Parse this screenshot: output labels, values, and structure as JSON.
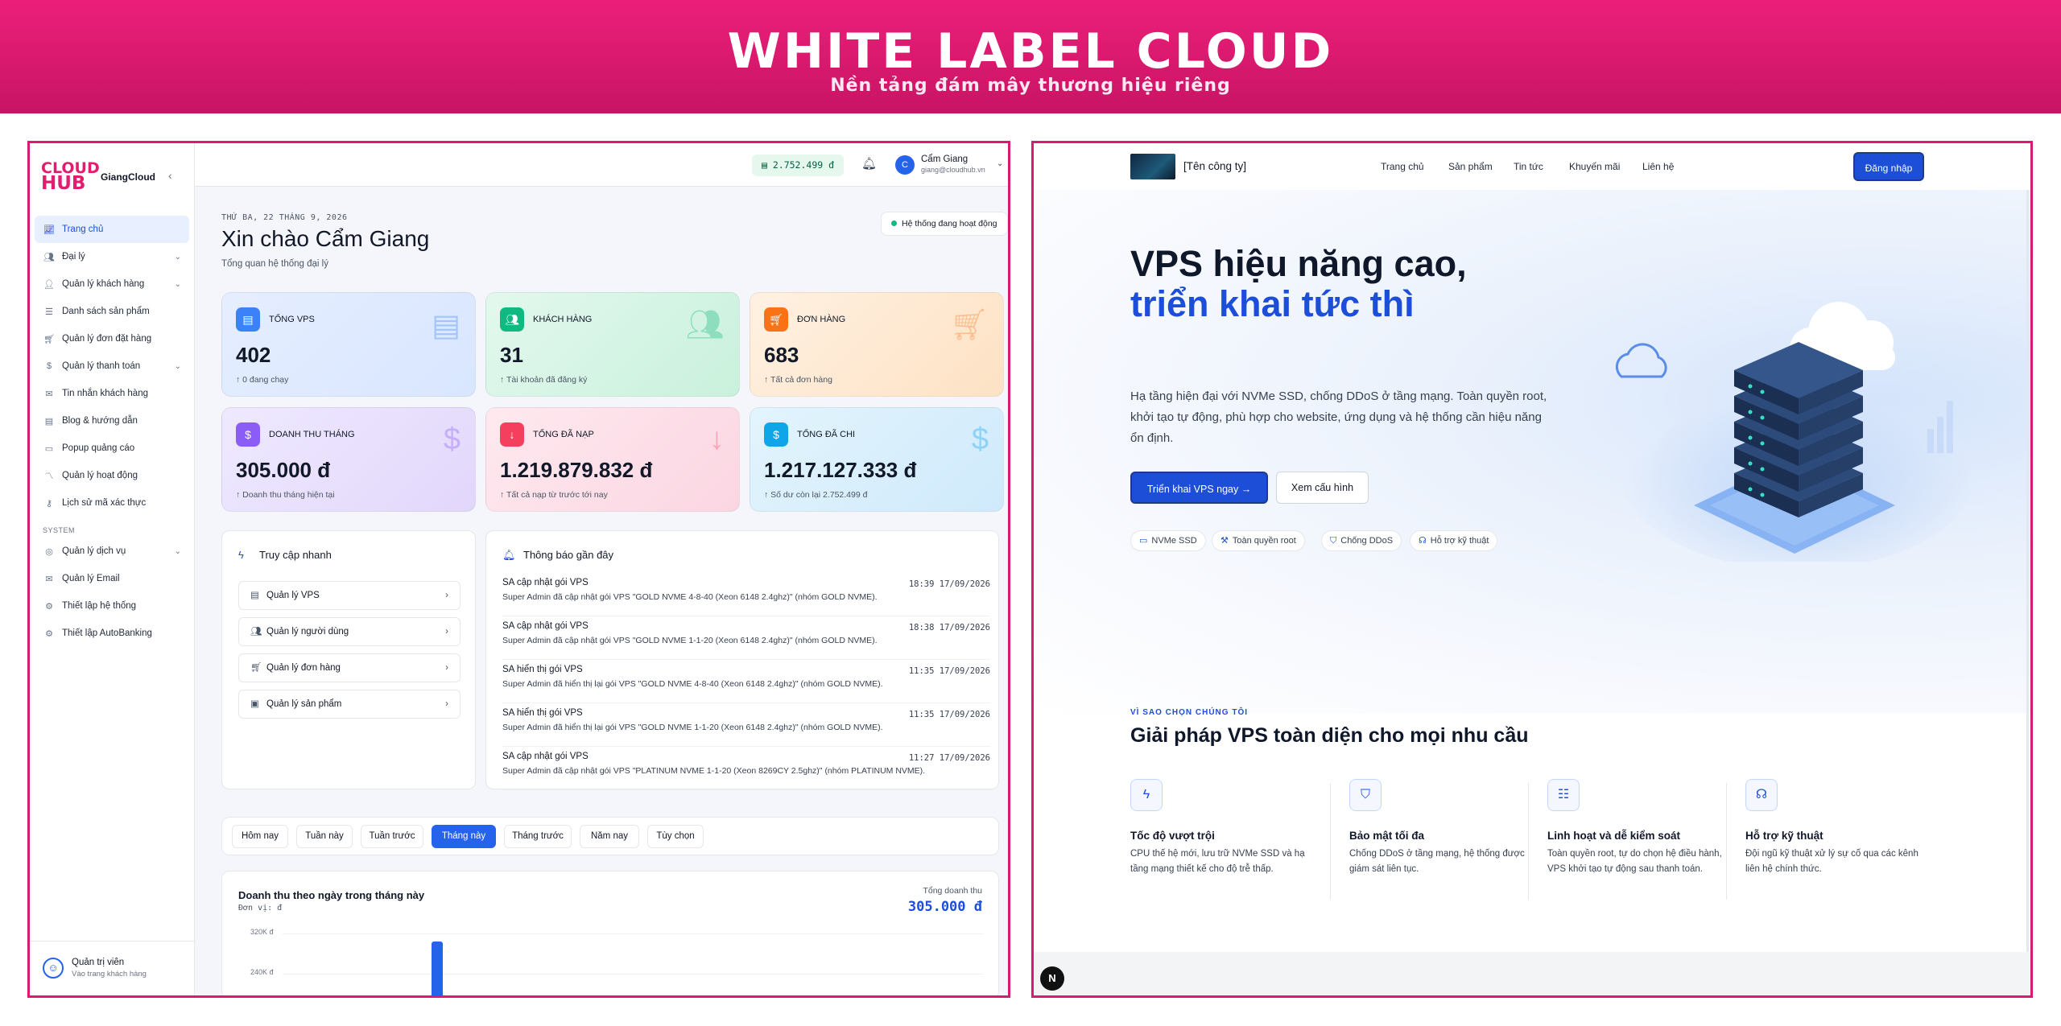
{
  "banner": {
    "title": "WHITE LABEL CLOUD",
    "subtitle": "Nền tảng đám mây thương hiệu riêng"
  },
  "admin": {
    "logo": {
      "line1": "CLOUD",
      "line2": "HUB"
    },
    "brand": "GiangCloud",
    "nav": [
      {
        "label": "Trang chủ",
        "icon": "chart-line-icon",
        "active": true
      },
      {
        "label": "Đại lý",
        "icon": "users-icon",
        "chevron": true
      },
      {
        "label": "Quản lý khách hàng",
        "icon": "user-icon",
        "chevron": true
      },
      {
        "label": "Danh sách sản phẩm",
        "icon": "list-icon"
      },
      {
        "label": "Quản lý đơn đặt hàng",
        "icon": "cart-icon"
      },
      {
        "label": "Quản lý thanh toán",
        "icon": "dollar-icon",
        "chevron": true
      },
      {
        "label": "Tin nhắn khách hàng",
        "icon": "message-icon"
      },
      {
        "label": "Blog & hướng dẫn",
        "icon": "book-icon"
      },
      {
        "label": "Popup quảng cáo",
        "icon": "popup-icon"
      },
      {
        "label": "Quản lý hoạt động",
        "icon": "activity-icon"
      },
      {
        "label": "Lịch sử mã xác thực",
        "icon": "key-icon"
      }
    ],
    "system_label": "SYSTEM",
    "system_nav": [
      {
        "label": "Quản lý dịch vụ",
        "icon": "globe-icon",
        "chevron": true
      },
      {
        "label": "Quản lý Email",
        "icon": "mail-icon"
      },
      {
        "label": "Thiết lập hệ thống",
        "icon": "gear-icon"
      },
      {
        "label": "Thiết lập AutoBanking",
        "icon": "gear-icon"
      }
    ],
    "footer_user": {
      "initial": "",
      "name": "Quản trị viên",
      "sub": "Vào trang khách hàng"
    },
    "topbar": {
      "balance": "2.752.499 đ",
      "user_initial": "C",
      "user_name": "Cẩm Giang",
      "user_email": "giang@cloudhub.vn"
    },
    "date": "THỨ BA, 22 THÁNG 9, 2026",
    "greeting": "Xin chào Cẩm Giang",
    "greeting_sub": "Tổng quan hệ thống đại lý",
    "status": "Hệ thống đang hoạt động",
    "cards": [
      {
        "title": "TỔNG VPS",
        "value": "402",
        "sub": "↑ 0 đang chạy",
        "icon": "server-icon",
        "color": "#3b82f6"
      },
      {
        "title": "KHÁCH HÀNG",
        "value": "31",
        "sub": "↑ Tài khoản đã đăng ký",
        "icon": "users-icon",
        "color": "#10b981"
      },
      {
        "title": "ĐƠN HÀNG",
        "value": "683",
        "sub": "↑ Tất cả đơn hàng",
        "icon": "cart-icon",
        "color": "#f97316"
      },
      {
        "title": "DOANH THU THÁNG",
        "value": "305.000 đ",
        "sub": "↑ Doanh thu tháng hiện tại",
        "icon": "dollar-icon",
        "color": "#8b5cf6"
      },
      {
        "title": "TỔNG ĐÃ NẠP",
        "value": "1.219.879.832 đ",
        "sub": "↑ Tất cả nạp từ trước tới nay",
        "icon": "download-icon",
        "color": "#f43f5e"
      },
      {
        "title": "TỔNG ĐÃ CHI",
        "value": "1.217.127.333 đ",
        "sub": "↑ Số dư còn lại 2.752.499 đ",
        "icon": "dollar-icon",
        "color": "#0ea5e9"
      }
    ],
    "quick": {
      "title": "Truy cập nhanh",
      "items": [
        "Quản lý VPS",
        "Quản lý người dùng",
        "Quản lý đơn hàng",
        "Quản lý sản phẩm"
      ]
    },
    "notifications": {
      "title": "Thông báo gần đây",
      "items": [
        {
          "title": "SA cập nhật gói VPS",
          "desc": "Super Admin đã cập nhật gói VPS \"GOLD NVME 4-8-40 (Xeon 6148 2.4ghz)\" (nhóm GOLD NVME).",
          "time": "18:39 17/09/2026"
        },
        {
          "title": "SA cập nhật gói VPS",
          "desc": "Super Admin đã cập nhật gói VPS \"GOLD NVME 1-1-20 (Xeon 6148 2.4ghz)\" (nhóm GOLD NVME).",
          "time": "18:38 17/09/2026"
        },
        {
          "title": "SA hiển thị gói VPS",
          "desc": "Super Admin đã hiển thị lại gói VPS \"GOLD NVME 4-8-40 (Xeon 6148 2.4ghz)\" (nhóm GOLD NVME).",
          "time": "11:35 17/09/2026"
        },
        {
          "title": "SA hiển thị gói VPS",
          "desc": "Super Admin đã hiển thị lại gói VPS \"GOLD NVME 1-1-20 (Xeon 6148 2.4ghz)\" (nhóm GOLD NVME).",
          "time": "11:35 17/09/2026"
        },
        {
          "title": "SA cập nhật gói VPS",
          "desc": "Super Admin đã cập nhật gói VPS \"PLATINUM NVME 1-1-20 (Xeon 8269CY 2.5ghz)\" (nhóm PLATINUM NVME).",
          "time": "11:27 17/09/2026"
        }
      ]
    },
    "tabs": [
      "Hôm nay",
      "Tuần này",
      "Tuần trước",
      "Tháng này",
      "Tháng trước",
      "Năm nay",
      "Tùy chọn"
    ],
    "tabs_active": 3,
    "revenue": {
      "title": "Doanh thu theo ngày trong tháng này",
      "unit": "Đơn vị: đ",
      "total_label": "Tổng doanh thu",
      "total_value": "305.000 đ",
      "y1": "320K đ",
      "y2": "240K đ"
    }
  },
  "landing": {
    "company": "[Tên công ty]",
    "links": [
      "Trang chủ",
      "Sản phẩm",
      "Tin tức",
      "Khuyến mãi",
      "Liên hệ"
    ],
    "login": "Đăng nhập",
    "headline1": "VPS hiệu năng cao,",
    "headline2": "triển khai tức thì",
    "desc": "Hạ tầng hiện đại với NVMe SSD, chống DDoS ở tầng mạng. Toàn quyền root, khởi tạo tự động, phù hợp cho website, ứng dụng và hệ thống cần hiệu năng ổn định.",
    "cta_primary": "Triển khai VPS ngay →",
    "cta_secondary": "Xem cấu hình",
    "pills": [
      "NVMe SSD",
      "Toàn quyền root",
      "Chống DDoS",
      "Hỗ trợ kỹ thuật"
    ],
    "why_label": "VÌ SAO CHỌN CHÚNG TÔI",
    "why_title": "Giải pháp VPS toàn diện cho mọi nhu cầu",
    "features": [
      {
        "title": "Tốc độ vượt trội",
        "desc": "CPU thế hệ mới, lưu trữ NVMe SSD và hạ tầng mạng thiết kế cho độ trễ thấp.",
        "icon": "bolt-icon"
      },
      {
        "title": "Bảo mật tối đa",
        "desc": "Chống DDoS ở tầng mạng, hệ thống được giám sát liên tục.",
        "icon": "shield-icon"
      },
      {
        "title": "Linh hoạt và dễ kiểm soát",
        "desc": "Toàn quyền root, tự do chọn hệ điều hành, VPS khởi tạo tự động sau thanh toán.",
        "icon": "sliders-icon"
      },
      {
        "title": "Hỗ trợ kỹ thuật",
        "desc": "Đội ngũ kỹ thuật xử lý sự cố qua các kênh liên hệ chính thức.",
        "icon": "headset-icon"
      }
    ],
    "badge": "N"
  }
}
